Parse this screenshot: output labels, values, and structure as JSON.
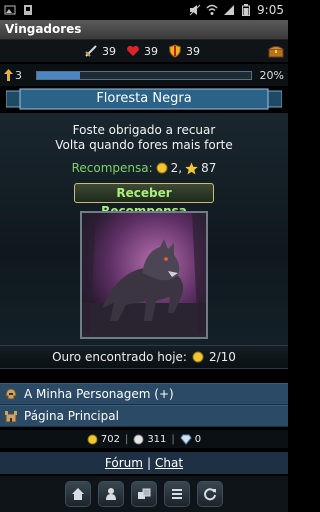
{
  "status_bar": {
    "time": "9:05"
  },
  "app": {
    "title": "Vingadores"
  },
  "stats": {
    "attack": "39",
    "health": "39",
    "defense": "39"
  },
  "level": {
    "number": "3",
    "progress_percent": "20%",
    "progress_fraction": 0.2
  },
  "location": {
    "title": "Floresta Negra"
  },
  "message": {
    "line1": "Foste obrigado a recuar",
    "line2": "Volta quando fores mais forte"
  },
  "reward": {
    "label": "Recompensa:",
    "gold": "2,",
    "xp": "87",
    "button_label": "Receber Recompensa"
  },
  "gold_today": {
    "label": "Ouro encontrado hoje:",
    "value": "2/10"
  },
  "menu": [
    {
      "label": "A Minha Personagem (+)"
    },
    {
      "label": "Página Principal"
    }
  ],
  "currency": {
    "gold": "702",
    "silver": "311",
    "diamonds": "0"
  },
  "links": {
    "forum": "Fórum",
    "chat": "Chat"
  },
  "colors": {
    "menu_bg": "#2a4a66",
    "reward_green": "#7cd36a",
    "xp_bar": "#4a86c4"
  },
  "bottom_nav": [
    "home-icon",
    "character-icon",
    "inventory-icon",
    "list-icon",
    "refresh-icon"
  ]
}
